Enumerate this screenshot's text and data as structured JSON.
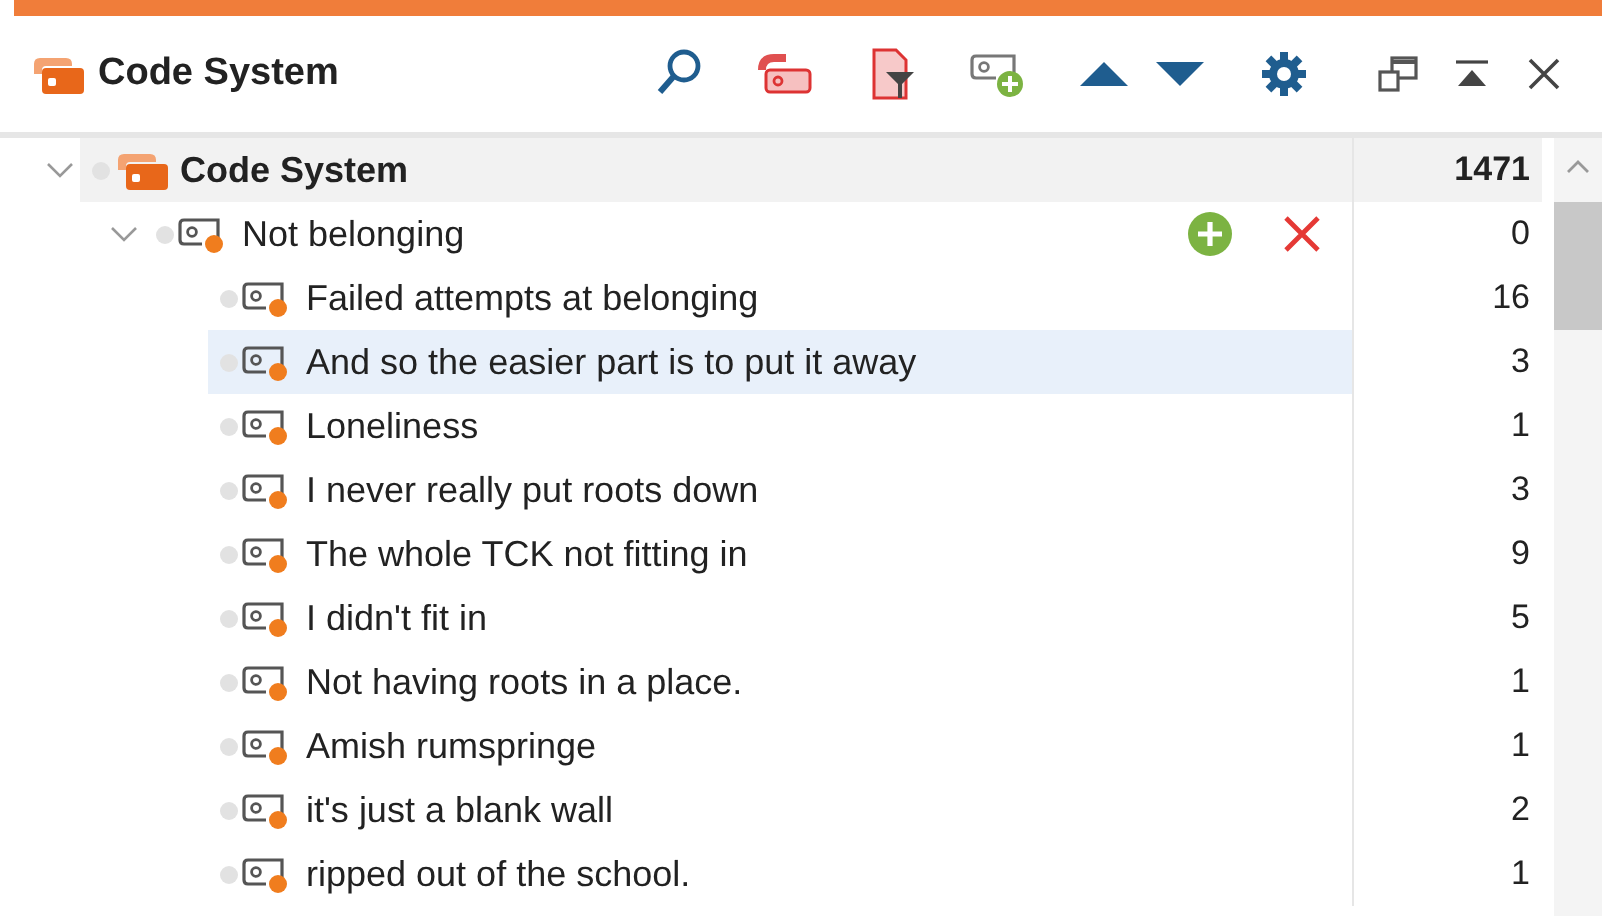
{
  "header": {
    "title": "Code System"
  },
  "tree": {
    "label": "Code System",
    "count": "1471",
    "expanded": true,
    "children": [
      {
        "label": "Not belonging",
        "count": "0",
        "expanded": true,
        "hovered": true,
        "selected": false,
        "children": [
          {
            "label": "Failed attempts at belonging",
            "count": "16",
            "selected": false
          },
          {
            "label": "And so the easier part is to put it away",
            "count": "3",
            "selected": true
          },
          {
            "label": "Loneliness",
            "count": "1",
            "selected": false
          },
          {
            "label": "I never really put roots down",
            "count": "3",
            "selected": false
          },
          {
            "label": "The whole TCK not fitting in",
            "count": "9",
            "selected": false
          },
          {
            "label": "I didn't fit in",
            "count": "5",
            "selected": false
          },
          {
            "label": "Not having roots in a place.",
            "count": "1",
            "selected": false
          },
          {
            "label": "Amish rumspringe",
            "count": "1",
            "selected": false
          },
          {
            "label": "it's just a blank wall",
            "count": "2",
            "selected": false
          },
          {
            "label": "ripped out of the school.",
            "count": "1",
            "selected": false
          }
        ]
      }
    ]
  }
}
